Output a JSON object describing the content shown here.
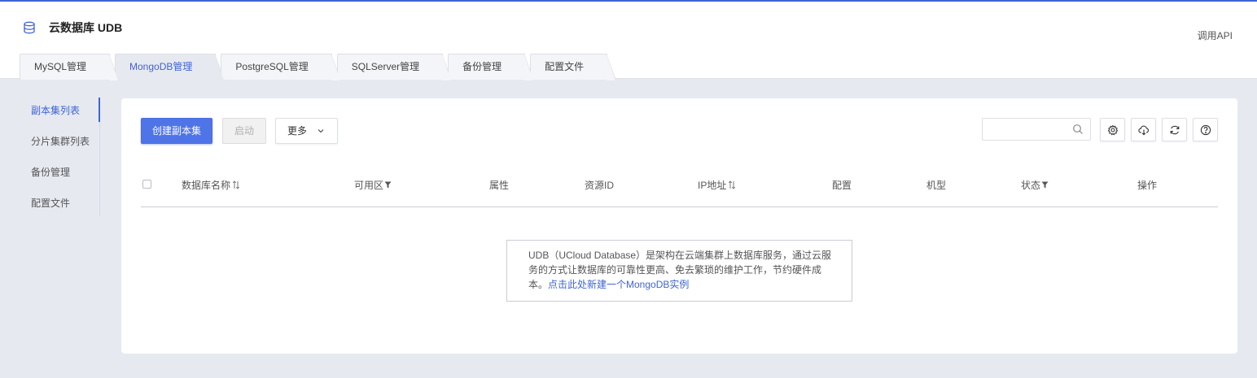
{
  "app": {
    "title": "云数据库 UDB",
    "api_link": "调用API"
  },
  "tabs": [
    {
      "label": "MySQL管理",
      "active": false
    },
    {
      "label": "MongoDB管理",
      "active": true
    },
    {
      "label": "PostgreSQL管理",
      "active": false
    },
    {
      "label": "SQLServer管理",
      "active": false
    },
    {
      "label": "备份管理",
      "active": false
    },
    {
      "label": "配置文件",
      "active": false
    }
  ],
  "sidebar": {
    "items": [
      {
        "label": "副本集列表",
        "active": true
      },
      {
        "label": "分片集群列表",
        "active": false
      },
      {
        "label": "备份管理",
        "active": false
      },
      {
        "label": "配置文件",
        "active": false
      }
    ]
  },
  "toolbar": {
    "create_label": "创建副本集",
    "start_label": "启动",
    "more_label": "更多",
    "search_placeholder": ""
  },
  "table": {
    "columns": [
      "数据库名称",
      "可用区",
      "属性",
      "资源ID",
      "IP地址",
      "配置",
      "机型",
      "状态",
      "操作"
    ]
  },
  "empty_state": {
    "line1": "UDB（UCloud Database）是架构在云端集群上数据库服务，通过云服",
    "line2": "务的方式让数据库的可靠性更高、免去繁琐的维护工作，节约硬件成",
    "line3_prefix": "本。",
    "link": "点击此处新建一个MongoDB实例"
  },
  "icons": {
    "app": "database-icon",
    "search": "search-icon",
    "settings": "gear-icon",
    "download": "cloud-download-icon",
    "refresh": "refresh-icon",
    "help": "help-icon"
  },
  "colors": {
    "accent": "#3f64d4",
    "primary_button": "#4f74e8",
    "background": "#e7e9f1"
  }
}
